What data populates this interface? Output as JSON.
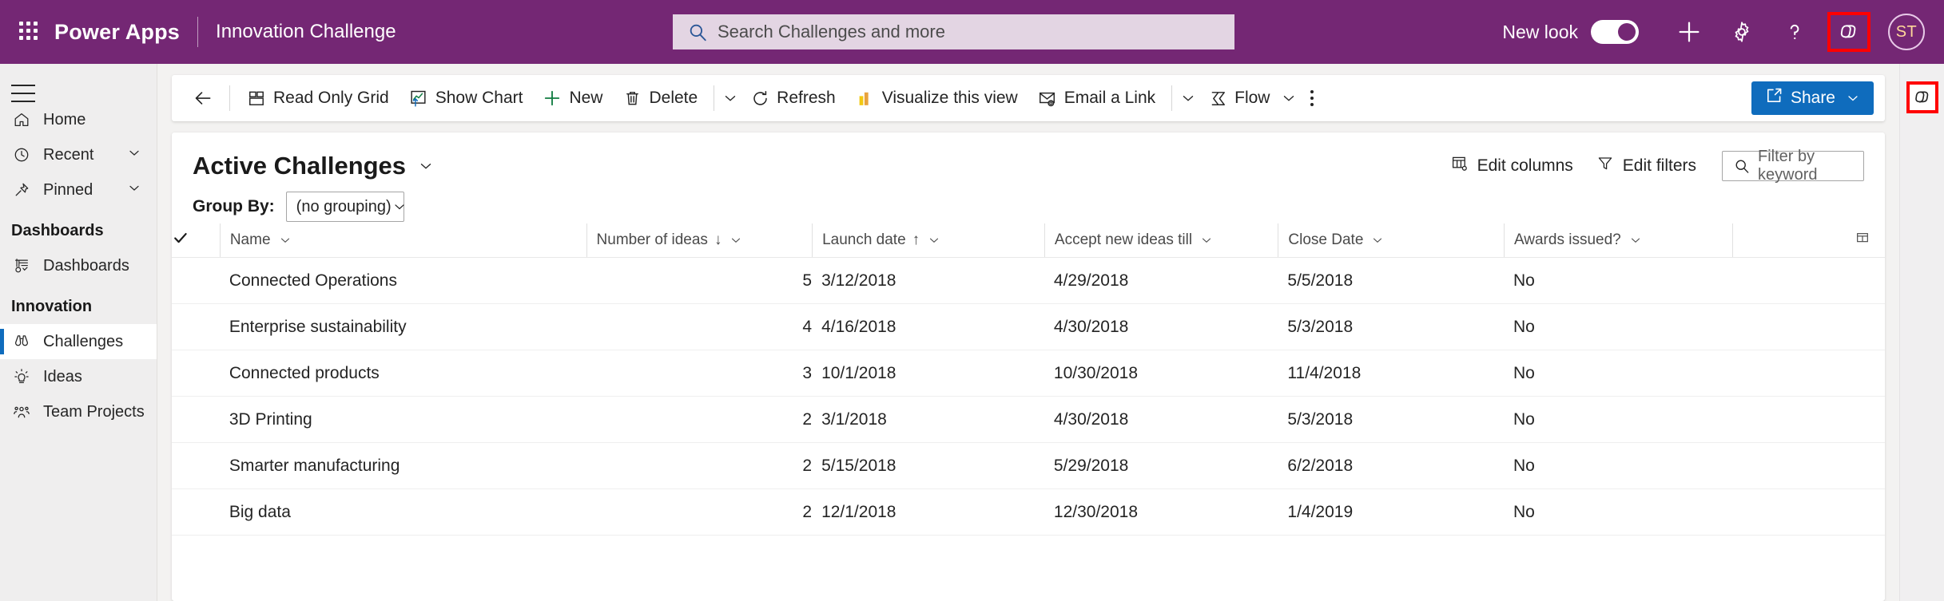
{
  "header": {
    "waffle_icon": "app-launcher-icon",
    "brand": "Power Apps",
    "app_name": "Innovation Challenge",
    "search": {
      "placeholder": "Search Challenges and more",
      "icon": "search-icon",
      "value": ""
    },
    "new_look_label": "New look",
    "new_look_on": true,
    "plus_label": "+",
    "question_label": "?",
    "icons": {
      "gear": "gear-icon",
      "help": "help-icon",
      "copilot": "copilot-icon",
      "plus": "plus-icon"
    },
    "avatar_initials": "ST",
    "accent_purple": "#742774",
    "highlight_color": "#ff0000"
  },
  "sidebar": {
    "hamburger_icon": "hamburger-menu-icon",
    "items": [
      {
        "label": "Home",
        "icon": "home-icon",
        "chevron": false,
        "selected": false
      },
      {
        "label": "Recent",
        "icon": "clock-icon",
        "chevron": true,
        "selected": false
      },
      {
        "label": "Pinned",
        "icon": "pin-icon",
        "chevron": true,
        "selected": false
      }
    ],
    "groups": [
      {
        "title": "Dashboards",
        "items": [
          {
            "label": "Dashboards",
            "icon": "dashboard-icon",
            "selected": false
          }
        ]
      },
      {
        "title": "Innovation",
        "items": [
          {
            "label": "Challenges",
            "icon": "binoculars-icon",
            "selected": true
          },
          {
            "label": "Ideas",
            "icon": "lightbulb-icon",
            "selected": false
          },
          {
            "label": "Team Projects",
            "icon": "people-icon",
            "selected": false
          }
        ]
      }
    ]
  },
  "commandbar": {
    "back_icon": "back-arrow-icon",
    "commands": [
      {
        "label": "Read Only Grid",
        "icon": "grid-icon"
      },
      {
        "label": "Show Chart",
        "icon": "chart-icon"
      },
      {
        "label": "New",
        "icon": "plus-icon"
      },
      {
        "label": "Delete",
        "icon": "trash-icon"
      }
    ],
    "overflow_caret_1": "chevron-down-icon",
    "commands2": [
      {
        "label": "Refresh",
        "icon": "refresh-icon"
      },
      {
        "label": "Visualize this view",
        "icon": "powerbi-icon"
      },
      {
        "label": "Email a Link",
        "icon": "email-icon"
      }
    ],
    "overflow_caret_2": "chevron-down-icon",
    "flow": {
      "label": "Flow",
      "icon": "flow-icon",
      "caret": "chevron-down-icon"
    },
    "more_icon": "more-kebab-icon",
    "share": {
      "label": "Share",
      "icon": "share-icon",
      "caret": "chevron-down-icon",
      "color": "#0f6cbd"
    }
  },
  "view": {
    "title": "Active Challenges",
    "title_chevron": "chevron-down-icon",
    "edit_columns": {
      "label": "Edit columns",
      "icon": "edit-columns-icon"
    },
    "edit_filters": {
      "label": "Edit filters",
      "icon": "funnel-icon"
    },
    "filter_keyword": {
      "placeholder": "Filter by keyword",
      "icon": "search-icon",
      "value": ""
    },
    "group_by": {
      "label": "Group By:",
      "value": "(no grouping)",
      "chevron": "chevron-down-icon"
    }
  },
  "grid": {
    "select_all_icon": "checkmark-icon",
    "columns": [
      {
        "label": "Name",
        "sort": "",
        "chevron": "chevron-down-icon"
      },
      {
        "label": "Number of ideas",
        "sort": "↓",
        "chevron": "chevron-down-icon"
      },
      {
        "label": "Launch date",
        "sort": "↑",
        "chevron": "chevron-down-icon"
      },
      {
        "label": "Accept new ideas till",
        "sort": "",
        "chevron": "chevron-down-icon"
      },
      {
        "label": "Close Date",
        "sort": "",
        "chevron": "chevron-down-icon"
      },
      {
        "label": "Awards issued?",
        "sort": "",
        "chevron": "chevron-down-icon"
      }
    ],
    "column_options_icon": "column-options-icon",
    "rows": [
      {
        "name": "Connected Operations",
        "ideas": "5",
        "launch": "3/12/2018",
        "accept": "4/29/2018",
        "close": "5/5/2018",
        "awards": "No"
      },
      {
        "name": "Enterprise sustainability",
        "ideas": "4",
        "launch": "4/16/2018",
        "accept": "4/30/2018",
        "close": "5/3/2018",
        "awards": "No"
      },
      {
        "name": "Connected products",
        "ideas": "3",
        "launch": "10/1/2018",
        "accept": "10/30/2018",
        "close": "11/4/2018",
        "awards": "No"
      },
      {
        "name": "3D Printing",
        "ideas": "2",
        "launch": "3/1/2018",
        "accept": "4/30/2018",
        "close": "5/3/2018",
        "awards": "No"
      },
      {
        "name": "Smarter manufacturing",
        "ideas": "2",
        "launch": "5/15/2018",
        "accept": "5/29/2018",
        "close": "6/2/2018",
        "awards": "No"
      },
      {
        "name": "Big data",
        "ideas": "2",
        "launch": "12/1/2018",
        "accept": "12/30/2018",
        "close": "1/4/2019",
        "awards": "No"
      }
    ]
  },
  "rightrail": {
    "copilot_icon": "copilot-icon"
  }
}
